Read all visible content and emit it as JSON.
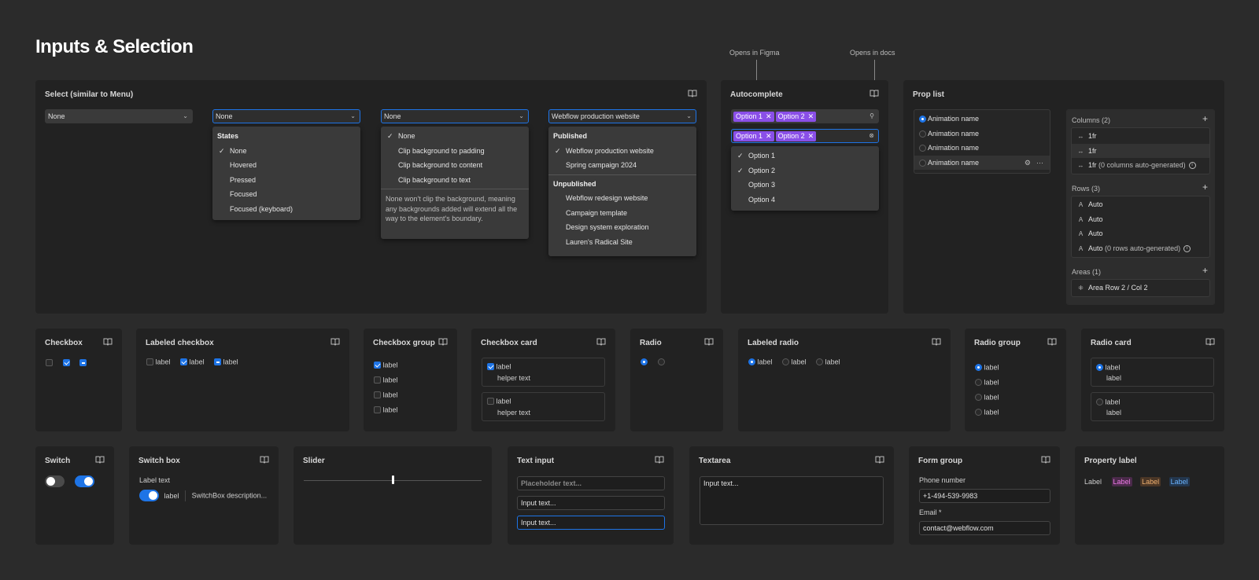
{
  "page_title": "Inputs & Selection",
  "notes": {
    "figma": "Opens in Figma",
    "docs": "Opens in docs"
  },
  "select": {
    "title": "Select (similar to Menu)",
    "s1": "None",
    "s2": "None",
    "s3": "None",
    "s4": "Webflow production website",
    "menu2": {
      "header": "States",
      "items": [
        "None",
        "Hovered",
        "Pressed",
        "Focused",
        "Focused (keyboard)"
      ]
    },
    "menu3": {
      "items": [
        "None",
        "Clip background to padding",
        "Clip background to content",
        "Clip background to text"
      ],
      "note": "None won't clip the background, meaning any backgrounds added will extend all the way to the element's boundary."
    },
    "menu4": {
      "published_header": "Published",
      "published": [
        "Webflow production website",
        "Spring campaign 2024"
      ],
      "unpublished_header": "Unpublished",
      "unpublished": [
        "Webflow redesign website",
        "Campaign template",
        "Design system exploration",
        "Lauren's Radical Site"
      ]
    }
  },
  "autocomplete": {
    "title": "Autocomplete",
    "chips": [
      "Option 1",
      "Option 2"
    ],
    "options": [
      "Option 1",
      "Option 2",
      "Option 3",
      "Option 4"
    ]
  },
  "proplist": {
    "title": "Prop list",
    "items": [
      "Animation name",
      "Animation name",
      "Animation name",
      "Animation name"
    ],
    "columns_label": "Columns (2)",
    "columns": [
      "1fr",
      "1fr",
      "1fr"
    ],
    "columns_note": "(0 columns auto-generated)",
    "rows_label": "Rows (3)",
    "rows": [
      "Auto",
      "Auto",
      "Auto",
      "Auto"
    ],
    "rows_note": "(0 rows auto-generated)",
    "areas_label": "Areas (1)",
    "area": "Area Row 2 / Col 2"
  },
  "checkbox": {
    "title": "Checkbox"
  },
  "labeled_checkbox": {
    "title": "Labeled checkbox",
    "label": "label"
  },
  "checkbox_group": {
    "title": "Checkbox group",
    "label": "label"
  },
  "checkbox_card": {
    "title": "Checkbox card",
    "label": "label",
    "helper": "helper text"
  },
  "radio": {
    "title": "Radio"
  },
  "labeled_radio": {
    "title": "Labeled radio",
    "label": "label"
  },
  "radio_group": {
    "title": "Radio group",
    "label": "label"
  },
  "radio_card": {
    "title": "Radio card",
    "label": "label"
  },
  "switch": {
    "title": "Switch"
  },
  "switch_box": {
    "title": "Switch box",
    "label_text": "Label text",
    "label": "label",
    "description": "SwitchBox description..."
  },
  "slider": {
    "title": "Slider",
    "value": 0.5
  },
  "text_input": {
    "title": "Text input",
    "placeholder": "Placeholder text...",
    "value1": "Input text...",
    "value2": "Input text..."
  },
  "textarea": {
    "title": "Textarea",
    "value": "Input text..."
  },
  "form_group": {
    "title": "Form group",
    "phone_label": "Phone number",
    "phone_value": "+1-494-539-9983",
    "email_label": "Email",
    "required": "*",
    "email_value": "contact@webflow.com"
  },
  "property_label": {
    "title": "Property label",
    "labels": [
      "Label",
      "Label",
      "Label",
      "Label"
    ]
  },
  "colors": {
    "accent": "#1e74e6",
    "chip": "#8a4fe8",
    "pink": "#e05ad8",
    "orange": "#e8a060",
    "blue": "#5aa8ff"
  }
}
